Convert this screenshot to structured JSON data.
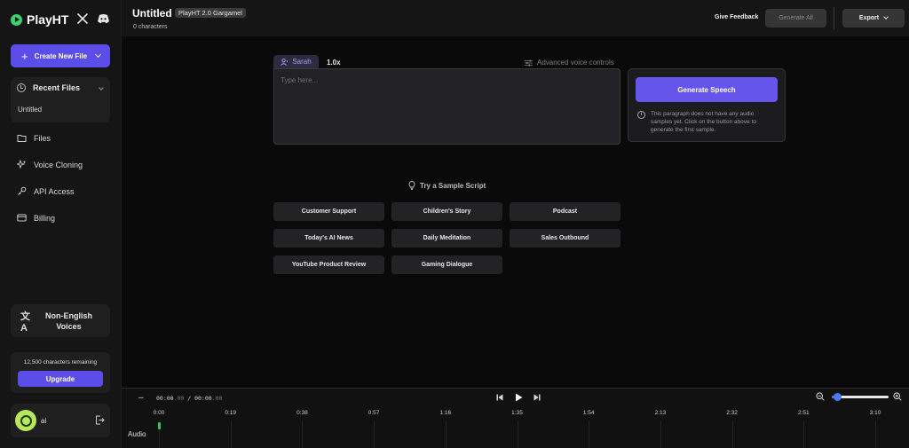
{
  "sidebar": {
    "brand": "PlayHT",
    "create_label": "Create New File",
    "recent_label": "Recent Files",
    "recent_file": "Untitled",
    "nav": [
      {
        "label": "Files",
        "icon": "folder-icon"
      },
      {
        "label": "Voice Cloning",
        "icon": "sparkle-icon"
      },
      {
        "label": "API Access",
        "icon": "key-icon"
      },
      {
        "label": "Billing",
        "icon": "card-icon"
      }
    ],
    "nonenglish_label": "Non-English Voices",
    "quota_text": "12,500 characters remaining",
    "upgrade_label": "Upgrade",
    "username": "ai"
  },
  "header": {
    "title": "Untitled",
    "model_badge": "PlayHT 2.0 Gargamel",
    "char_count": "0 characters",
    "feedback_label": "Give Feedback",
    "generate_all_label": "Generate All",
    "export_label": "Export"
  },
  "editor": {
    "voice_name": "Sarah",
    "speed": "1.0x",
    "advanced_label": "Advanced voice controls",
    "placeholder": "Type here...",
    "generate_label": "Generate Speech",
    "generate_note": "This paragraph does not have any audio samples yet. Click on the button above to generate the first sample."
  },
  "samples": {
    "heading": "Try a Sample Script",
    "items": [
      "Customer Support",
      "Children's Story",
      "Podcast",
      "Today's AI News",
      "Daily Meditation",
      "Sales Outbound",
      "YouTube Product Review",
      "Gaming Dialogue"
    ]
  },
  "timeline": {
    "current_time": "00:00",
    "current_ms": ".00",
    "separator": "/",
    "total_time": "00:00",
    "total_ms": ".00",
    "ticks": [
      "0:00",
      "0:19",
      "0:38",
      "0:57",
      "1:16",
      "1:35",
      "1:54",
      "2:13",
      "2:32",
      "2:51",
      "3:10"
    ],
    "track_label": "Audio",
    "zoom_level": 0.1
  },
  "colors": {
    "accent": "#5b4ee8",
    "brand_green": "#3bd16f",
    "playhead": "#2ec866"
  }
}
